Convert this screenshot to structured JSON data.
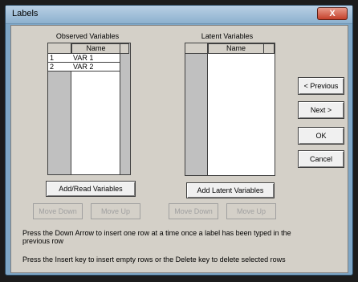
{
  "window": {
    "title": "Labels",
    "close_glyph": "X"
  },
  "observed": {
    "label": "Observed Variables",
    "column_header": "Name",
    "rows": [
      {
        "num": "1",
        "name": "VAR 1"
      },
      {
        "num": "2",
        "name": "VAR 2"
      }
    ],
    "add_button": "Add/Read Variables",
    "move_down": "Move Down",
    "move_up": "Move Up"
  },
  "latent": {
    "label": "Latent Variables",
    "column_header": "Name",
    "add_button": "Add Latent Variables",
    "move_down": "Move Down",
    "move_up": "Move Up"
  },
  "side_buttons": {
    "previous": "< Previous",
    "next": "Next >",
    "ok": "OK",
    "cancel": "Cancel"
  },
  "messages": {
    "line1": "Press the Down Arrow to insert one row at a time once a label has been typed in the",
    "line1b": "previous row",
    "line2": "Press the Insert key to insert empty rows or the Delete key to delete selected rows"
  }
}
